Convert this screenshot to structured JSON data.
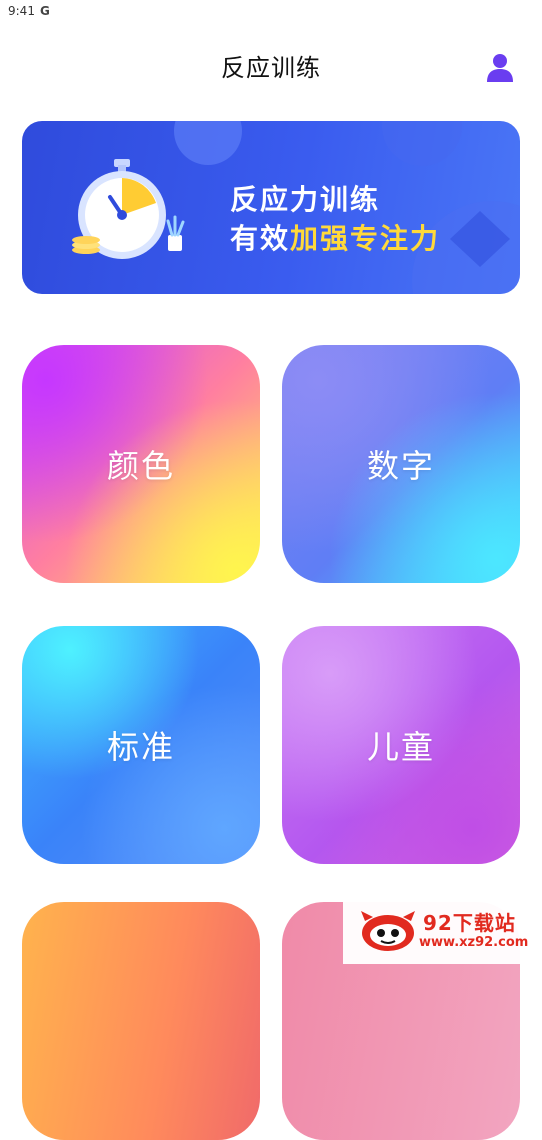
{
  "status_bar": {
    "time": "9:41",
    "carrier_icon": "G"
  },
  "header": {
    "title": "反应训练",
    "user_icon": "user-icon"
  },
  "banner": {
    "line1": "反应力训练",
    "line2_prefix": "有效",
    "line2_highlight": "加强专注力",
    "illustration": "stopwatch-icon",
    "highlight_color": "#ffd93a"
  },
  "cards": [
    {
      "label": "颜色"
    },
    {
      "label": "数字"
    },
    {
      "label": "标准"
    },
    {
      "label": "儿童"
    },
    {
      "label": ""
    },
    {
      "label": ""
    }
  ],
  "watermark": {
    "brand": "92下载站",
    "url": "www.xz92.com"
  }
}
